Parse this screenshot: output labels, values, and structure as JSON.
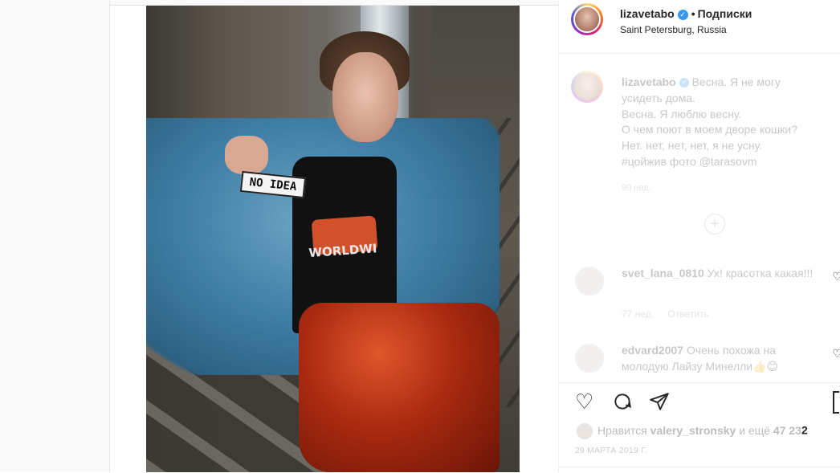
{
  "post": {
    "username": "lizavetabo",
    "dot": "•",
    "follow_label": "Подписки",
    "location": "Saint Petersburg, Russia"
  },
  "photo": {
    "patch_text": "NO IDEA",
    "shirt_print": "WORLDWI"
  },
  "caption": {
    "username": "lizavetabo",
    "lines": [
      "Весна. Я не могу",
      "усидеть дома.",
      "Весна. Я люблю весну.",
      "О чем поют в моем дворе кошки?",
      "Нет. нет, нет, нет, я не усну.",
      "#цойжив фото @tarasovm"
    ],
    "time": "90 нед."
  },
  "load_more": "+",
  "comments": [
    {
      "username": "svet_lana_0810",
      "text": "Ух! красотка какая!!!",
      "time": "77 нед.",
      "reply": "Ответить"
    },
    {
      "username": "edvard2007",
      "text": "Очень похожа на молодую Лайзу Минелли👍😊"
    }
  ],
  "likes": {
    "prefix": "Нравится",
    "user": "valery_stronsky",
    "and": "и ещё",
    "count": "47 23",
    "count_tail": "2"
  },
  "date": "29 МАРТА 2019 Г."
}
